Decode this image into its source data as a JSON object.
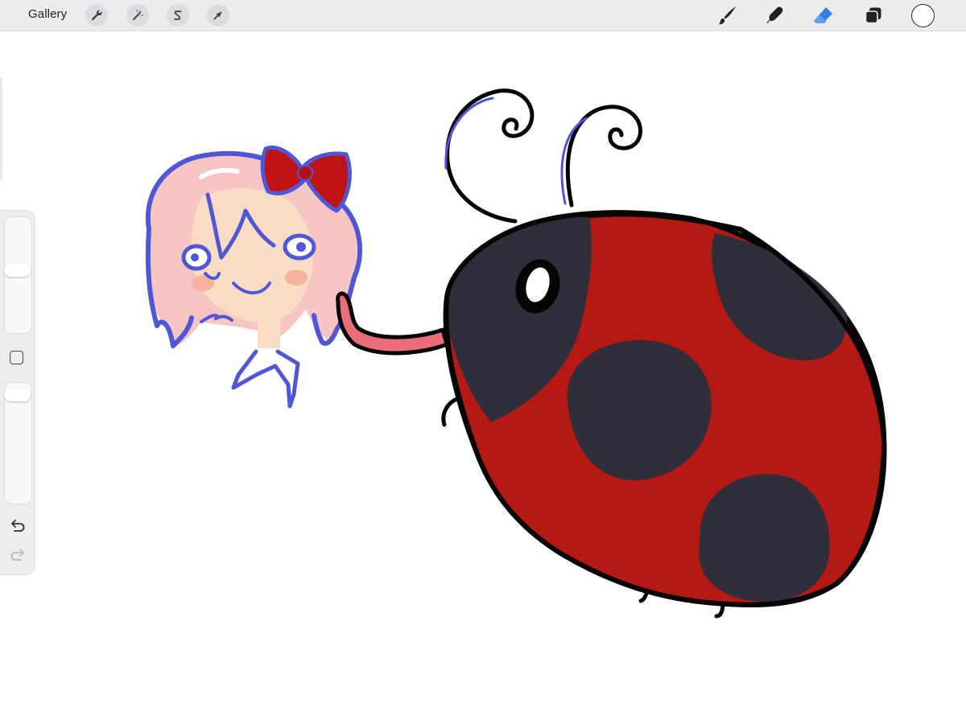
{
  "app": {
    "gallery_label": "Gallery"
  },
  "toolbar_left": [
    {
      "name": "actions-icon"
    },
    {
      "name": "adjustments-icon"
    },
    {
      "name": "selection-icon"
    },
    {
      "name": "transform-icon"
    }
  ],
  "toolbar_right": [
    {
      "name": "brush-icon"
    },
    {
      "name": "smudge-icon"
    },
    {
      "name": "eraser-icon",
      "active": true,
      "color": "#2f7fe4"
    },
    {
      "name": "layers-icon"
    }
  ],
  "current_color": "#ffffff",
  "sidebar": {
    "brush_size_level": 0.55,
    "brush_opacity_level": 0.95,
    "modify_button": "square-icon",
    "undo": "undo-icon",
    "redo": "redo-icon"
  },
  "artwork": {
    "colors": {
      "ladybug_red": "#b51913",
      "ladybug_dark": "#2e2f3a",
      "outline": "#050505",
      "hair_pink": "#f7c5c4",
      "line_blue": "#4f57d6",
      "bow_red": "#c01414",
      "tongue": "#ea6d7a",
      "skin": "#f9dcc4"
    }
  }
}
